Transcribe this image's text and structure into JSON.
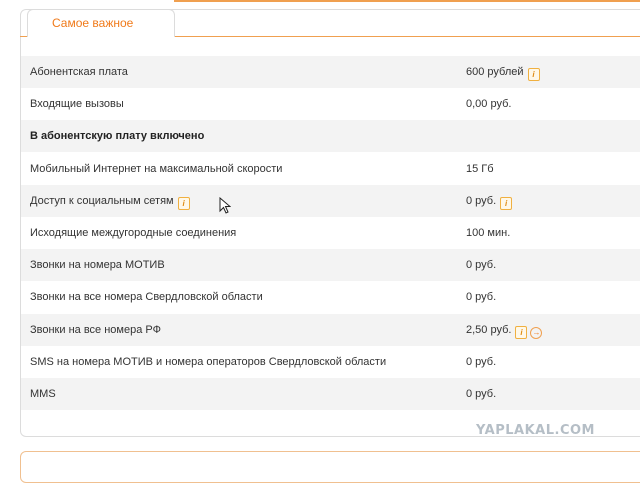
{
  "tab": {
    "label": "Самое важное"
  },
  "rows": [
    {
      "label": "Абонентская плата",
      "value": "600 рублей",
      "label_info": false,
      "value_info": true,
      "value_arrow": false,
      "section": false,
      "alt": true
    },
    {
      "label": "Входящие вызовы",
      "value": "0,00 руб.",
      "label_info": false,
      "value_info": false,
      "value_arrow": false,
      "section": false,
      "alt": false
    },
    {
      "label": "В абонентскую плату включено",
      "value": "",
      "label_info": false,
      "value_info": false,
      "value_arrow": false,
      "section": true,
      "alt": true
    },
    {
      "label": "Мобильный Интернет на максимальной скорости",
      "value": "15 Гб",
      "label_info": false,
      "value_info": false,
      "value_arrow": false,
      "section": false,
      "alt": false
    },
    {
      "label": "Доступ к социальным сетям",
      "value": "0 руб.",
      "label_info": true,
      "value_info": true,
      "value_arrow": false,
      "section": false,
      "alt": true
    },
    {
      "label": "Исходящие междугородные соединения",
      "value": "100 мин.",
      "label_info": false,
      "value_info": false,
      "value_arrow": false,
      "section": false,
      "alt": false
    },
    {
      "label": "Звонки на номера МОТИВ",
      "value": "0 руб.",
      "label_info": false,
      "value_info": false,
      "value_arrow": false,
      "section": false,
      "alt": true
    },
    {
      "label": "Звонки на все номера Свердловской области",
      "value": "0 руб.",
      "label_info": false,
      "value_info": false,
      "value_arrow": false,
      "section": false,
      "alt": false
    },
    {
      "label": "Звонки на все номера РФ",
      "value": "2,50 руб.",
      "label_info": false,
      "value_info": true,
      "value_arrow": true,
      "section": false,
      "alt": true
    },
    {
      "label": "SMS на номера МОТИВ и номера операторов Свердловской области",
      "value": "0 руб.",
      "label_info": false,
      "value_info": false,
      "value_arrow": false,
      "section": false,
      "alt": false
    },
    {
      "label": "MMS",
      "value": "0 руб.",
      "label_info": false,
      "value_info": false,
      "value_arrow": false,
      "section": false,
      "alt": true
    }
  ],
  "icons": {
    "info": "info-icon",
    "arrow": "arrow-right-circle-icon",
    "cursor": "mouse-cursor-icon"
  },
  "watermark": "YAPLAKAL.COM",
  "colors": {
    "accent": "#f07a1a",
    "row_alt": "#f3f3f3"
  }
}
